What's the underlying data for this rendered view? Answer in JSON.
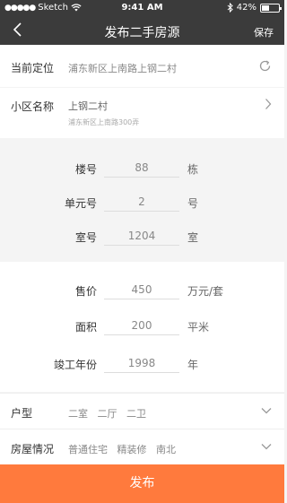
{
  "status_bar": {
    "carrier": "Sketch",
    "time": "9:41 AM",
    "battery": "42%"
  },
  "nav": {
    "title": "发布二手房源",
    "save": "保存"
  },
  "location": {
    "label": "当前定位",
    "value": "浦东新区上南路上钢二村"
  },
  "community": {
    "label": "小区名称",
    "name": "上钢二村",
    "address": "浦东新区上南路300弄"
  },
  "building": {
    "fields": [
      {
        "label": "楼号",
        "value": "88",
        "unit": "栋"
      },
      {
        "label": "单元号",
        "value": "2",
        "unit": "号"
      },
      {
        "label": "室号",
        "value": "1204",
        "unit": "室"
      }
    ]
  },
  "pricing": {
    "fields": [
      {
        "label": "售价",
        "value": "450",
        "unit": "万元/套"
      },
      {
        "label": "面积",
        "value": "200",
        "unit": "平米"
      },
      {
        "label": "竣工年份",
        "value": "1998",
        "unit": "年"
      }
    ]
  },
  "layout": {
    "label": "户型",
    "values": [
      "二室",
      "二厅",
      "二卫"
    ]
  },
  "condition": {
    "label": "房屋情况",
    "values": [
      "普通住宅",
      "精装修",
      "南北"
    ]
  },
  "publish_button": "发布",
  "colors": {
    "header": "#3b3b3b",
    "accent": "#ff7a3d"
  },
  "battery_level": 0.42
}
